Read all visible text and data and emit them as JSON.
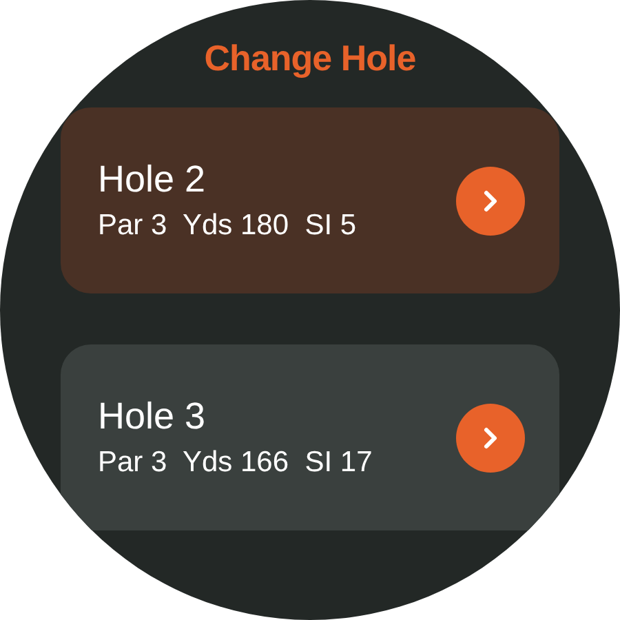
{
  "title": "Change Hole",
  "holes": [
    {
      "name": "Hole 2",
      "details": "Par 3  Yds 180  SI 5",
      "selected": true
    },
    {
      "name": "Hole 3",
      "details": "Par 3  Yds 166  SI 17",
      "selected": false
    }
  ]
}
